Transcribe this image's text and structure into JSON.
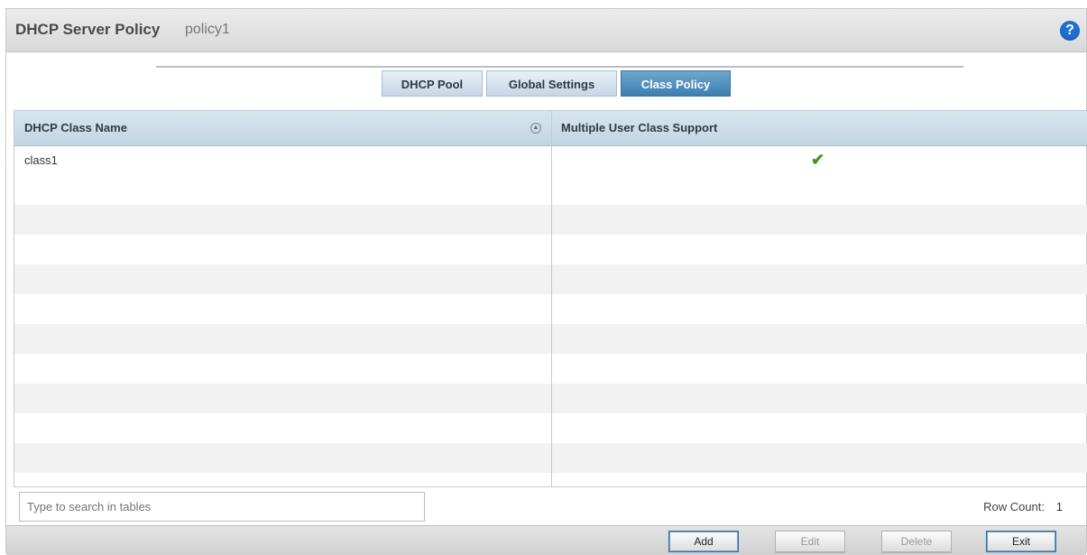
{
  "header": {
    "title": "DHCP Server Policy",
    "policy_name": "policy1",
    "help_icon": "?"
  },
  "tabs": [
    {
      "label": "DHCP Pool",
      "active": false
    },
    {
      "label": "Global Settings",
      "active": false
    },
    {
      "label": "Class Policy",
      "active": true
    }
  ],
  "table": {
    "columns": [
      "DHCP Class Name",
      "Multiple User Class Support"
    ],
    "rows": [
      {
        "class_name": "class1",
        "multiple_user_class_support": true
      }
    ],
    "check_icon": "✔"
  },
  "search": {
    "placeholder": "Type to search in tables"
  },
  "row_count": {
    "label": "Row Count:",
    "value": "1"
  },
  "buttons": {
    "add": "Add",
    "edit": "Edit",
    "delete": "Delete",
    "exit": "Exit"
  },
  "colors": {
    "active_tab": "#3d7eb0",
    "help_icon": "#1f6fd0",
    "check": "#3a9a1a"
  }
}
